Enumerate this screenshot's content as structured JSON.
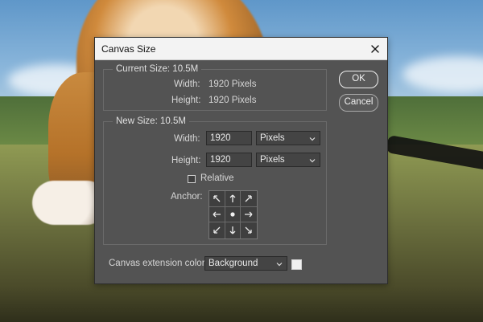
{
  "dialog": {
    "title": "Canvas Size",
    "buttons": {
      "ok_label": "OK",
      "cancel_label": "Cancel"
    },
    "current": {
      "legend": "Current Size: 10.5M",
      "width_label": "Width:",
      "width_value": "1920 Pixels",
      "height_label": "Height:",
      "height_value": "1920 Pixels"
    },
    "new": {
      "legend": "New Size: 10.5M",
      "width_label": "Width:",
      "width_value": "1920",
      "width_unit": "Pixels",
      "height_label": "Height:",
      "height_value": "1920",
      "height_unit": "Pixels",
      "relative_label": "Relative",
      "relative_checked": false,
      "anchor_label": "Anchor:"
    },
    "extension": {
      "label": "Canvas extension color:",
      "value": "Background",
      "swatch_color": "#f0f0f0"
    }
  },
  "icons": {
    "close": "close-icon",
    "chevron": "chevron-down-icon",
    "anchor_center": "dot-icon",
    "anchor_arrows": [
      "arrow-up-left-icon",
      "arrow-up-icon",
      "arrow-up-right-icon",
      "arrow-left-icon",
      "dot-icon",
      "arrow-right-icon",
      "arrow-down-left-icon",
      "arrow-down-icon",
      "arrow-down-right-icon"
    ]
  }
}
